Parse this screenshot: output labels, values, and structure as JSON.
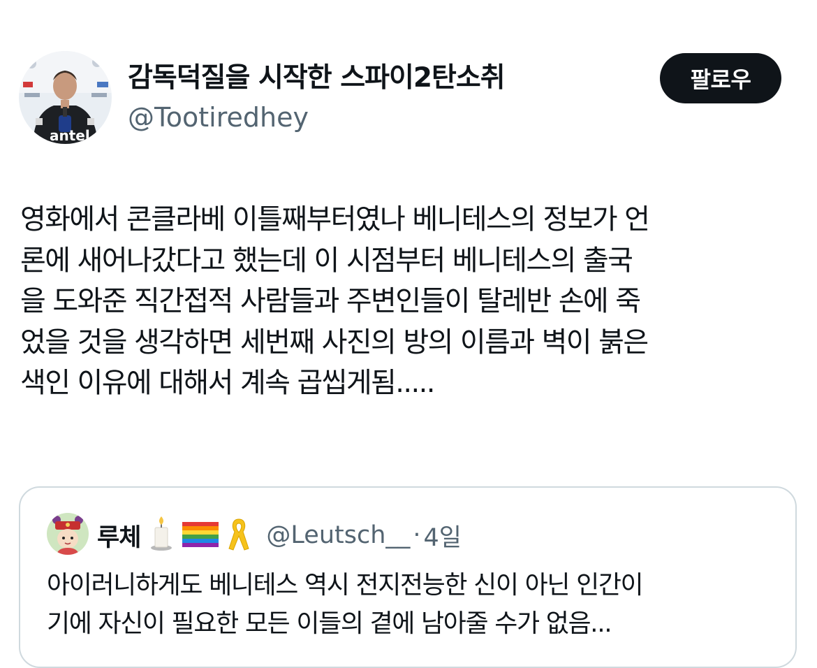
{
  "tweet": {
    "author": {
      "display_name": "감독덕질을 시작한 스파이2탄소취",
      "handle": "@Tootiredhey",
      "avatar_icon": "coach-photo-avatar"
    },
    "follow_label": "팔로우",
    "text_lines": [
      "영화에서 콘클라베 이틀째부터였나 베니테스의 정보가 언",
      "론에 새어나갔다고 했는데 이 시점부터 베니테스의 출국",
      "을 도와준 직간접적 사람들과 주변인들이 탈레반 손에 죽",
      "었을 것을 생각하면 세번째 사진의 방의 이름과 벽이 붉은",
      "색인 이유에 대해서 계속 곱씹게됨....."
    ]
  },
  "quote": {
    "author": {
      "display_name": "루체",
      "emojis": [
        "candle-icon",
        "rainbow-flag-icon",
        "yellow-ribbon-icon"
      ],
      "handle": "@Leutsch__",
      "separator": "·",
      "time": "4일"
    },
    "text_lines": [
      "아이러니하게도 베니테스 역시 전지전능한 신이 아닌 인간이",
      "기에 자신이 필요한 모든 이들의 곁에 남아줄 수가 없음..."
    ]
  },
  "colors": {
    "text_primary": "#0f1419",
    "text_secondary": "#536471",
    "border": "#cfd9de",
    "button_bg": "#0f1419"
  }
}
